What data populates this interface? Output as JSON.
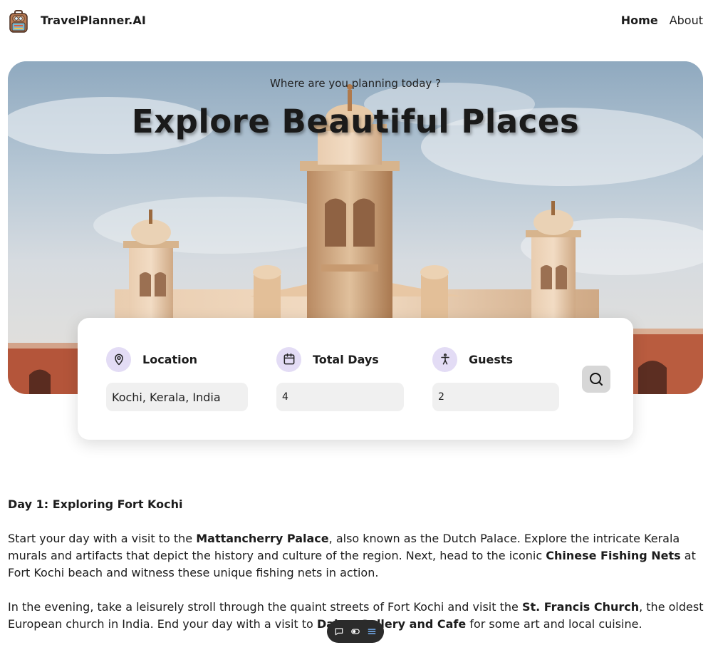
{
  "header": {
    "brand": "TravelPlanner.AI",
    "nav": {
      "home": "Home",
      "about": "About"
    }
  },
  "hero": {
    "subtitle": "Where are you planning today ?",
    "title": "Explore Beautiful Places"
  },
  "search": {
    "location": {
      "label": "Location",
      "value": "Kochi, Kerala, India",
      "icon": "map-pin-icon"
    },
    "days": {
      "label": "Total Days",
      "value": "4",
      "icon": "calendar-icon"
    },
    "guests": {
      "label": "Guests",
      "value": "2",
      "icon": "person-icon"
    },
    "button_icon": "search-icon"
  },
  "itinerary": {
    "day1_title": "Day 1: Exploring Fort Kochi",
    "p1": {
      "t1": "Start your day with a visit to the ",
      "b1": "Mattancherry Palace",
      "t2": ", also known as the Dutch Palace. Explore the intricate Kerala murals and artifacts that depict the history and culture of the region. Next, head to the iconic ",
      "b2": "Chinese Fishing Nets",
      "t3": " at Fort Kochi beach and witness these unique fishing nets in action."
    },
    "p2": {
      "t1": "In the evening, take a leisurely stroll through the quaint streets of Fort Kochi and visit the ",
      "b1": "St. Francis Church",
      "t2": ", the oldest European church in India. End your day with a visit to ",
      "b2": "Dal",
      "b3": "Gallery and Cafe",
      "t3": " for some art and local cuisine."
    }
  },
  "toolbar": {
    "icons": [
      "comment-icon",
      "toggle-icon",
      "list-icon"
    ]
  },
  "colors": {
    "icon_bg": "#e3dcf5",
    "input_bg": "#f0f0f0",
    "toolbar_bg": "#2b2b2b"
  }
}
